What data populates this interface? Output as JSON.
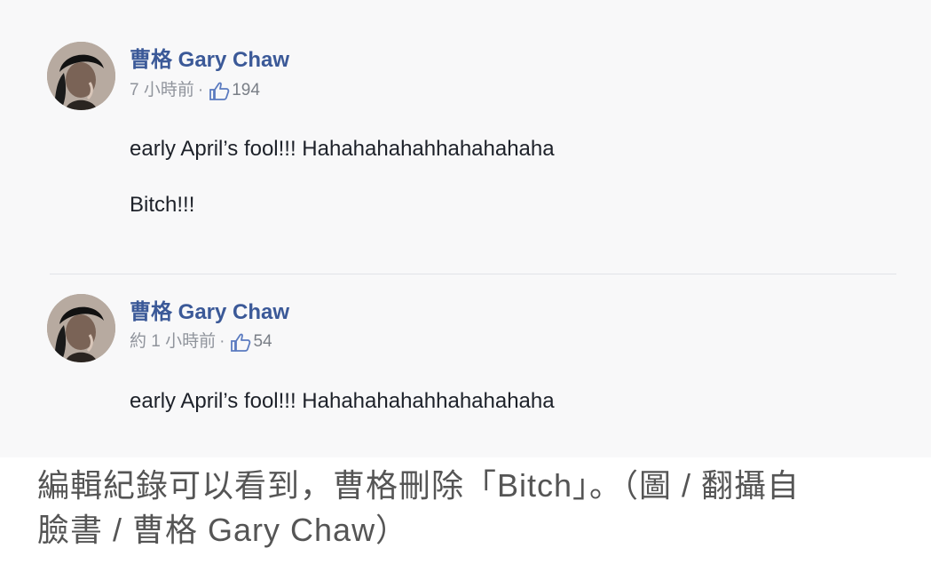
{
  "posts": [
    {
      "author": "曹格 Gary Chaw",
      "time": "7 小時前",
      "separator": "·",
      "likes": "194",
      "lines": [
        "early April’s fool!!! Hahahahahahhahahahaha",
        "Bitch!!!"
      ]
    },
    {
      "author": "曹格 Gary Chaw",
      "time": "約 1 小時前",
      "separator": "·",
      "likes": "54",
      "lines": [
        "early April’s fool!!! Hahahahahahhahahahaha"
      ]
    }
  ],
  "icons": {
    "avatar": "profile-photo",
    "like": "thumbs-up-icon"
  },
  "colors": {
    "author_link": "#3b5998",
    "meta_text": "#90949c",
    "body_text": "#1d2129",
    "caption_text": "#555555"
  },
  "caption": {
    "line_1": "編輯紀錄可以看到，曹格刪除「Bitch」。（圖 / 翻攝自",
    "line_2": "臉書 / 曹格 Gary Chaw）"
  }
}
